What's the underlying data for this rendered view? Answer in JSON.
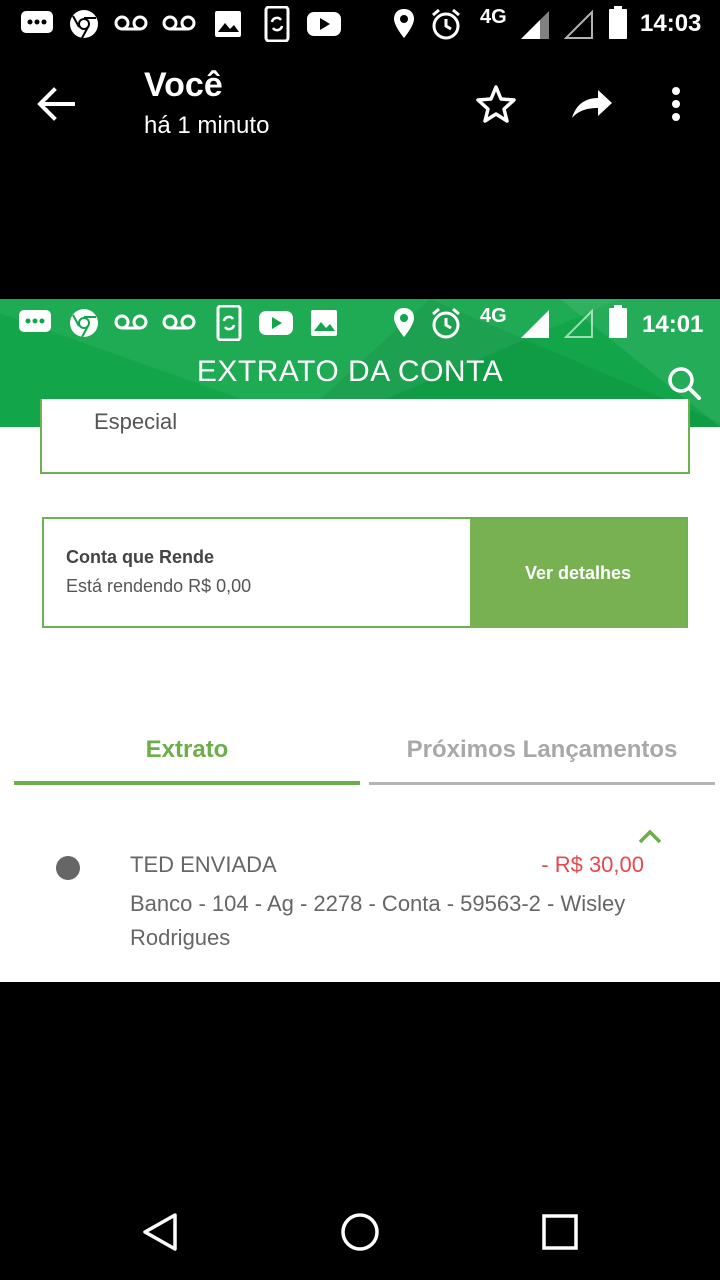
{
  "viewer": {
    "status_bar": {
      "time": "14:03",
      "network": "4G"
    },
    "title": "Você",
    "subtitle": "há 1 minuto"
  },
  "screenshot": {
    "status_bar": {
      "time": "14:01",
      "network": "4G"
    },
    "header": {
      "title": "EXTRATO DA CONTA"
    },
    "top_card": {
      "text": "Especial"
    },
    "conta_que_rende": {
      "title": "Conta que Rende",
      "subtitle": "Está rendendo R$ 0,00",
      "button_label": "Ver detalhes"
    },
    "tabs": [
      {
        "label": "Extrato",
        "active": true
      },
      {
        "label": "Próximos Lançamentos",
        "active": false
      }
    ],
    "transaction": {
      "title": "TED ENVIADA",
      "amount": "- R$ 30,00",
      "description": "Banco - 104 - Ag - 2278 - Conta - 59563-2 - Wisley Rodrigues"
    }
  },
  "colors": {
    "brand_green": "#12a54a",
    "accent_green": "#6cae4a",
    "button_green": "#78b152",
    "negative_red": "#e5484d"
  }
}
